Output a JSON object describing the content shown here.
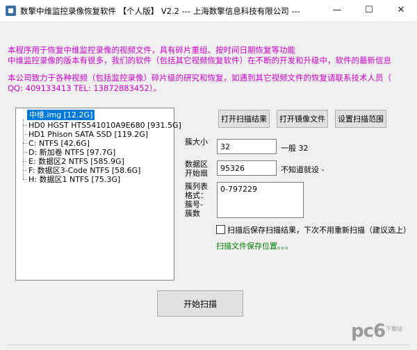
{
  "window": {
    "title": "数擎中维监控录像恢复软件 【个人版】 V2.2 --- 上海数擎信息科技有限公司 ---",
    "minimize_glyph": "—",
    "maximize_glyph": "☐",
    "close_glyph": "✕"
  },
  "info": {
    "line1": "本程序用于恢复中维监控录像的视频文件，具有碎片重组、按时间日期恢复等功能",
    "line2": "中维监控录像的版本有很多，我们的软件（包括其它视频恢复软件）在不断的开发和升级中，软件的最新信息",
    "line3": "本公司致力于各种视频（包括监控录像）碎片级的研究和恢复，如遇到其它视频文件的恢复请联系技术人员（",
    "line4": "QQ: 409133413 TEL: 13872883452）。",
    "color": "#cc00cc"
  },
  "tree": {
    "root": "中维.img  [12.2G]",
    "items": [
      "HD0 HGST HTS541010A9E680 [931.5G]",
      "HD1 Phison SATA SSD [119.2G]",
      "C:  NTFS [42.6G]",
      "D: 新加卷 NTFS [97.7G]",
      "E: 数据区2 NTFS [585.9G]",
      "F: 数据区3-Code NTFS [58.6G]",
      "H: 数据区1 NTFS [75.3G]"
    ]
  },
  "buttons": {
    "open_scan_result": "打开扫描结果",
    "open_image_file": "打开镜像文件",
    "set_scan_range": "设置扫描范围",
    "start_scan": "开始扫描"
  },
  "form": {
    "cluster_size_label": "簇大小",
    "cluster_size_value": "32",
    "cluster_size_hint": "一般 32",
    "data_start_label": "数据区开始扇",
    "data_start_value": "95326",
    "data_start_hint": "不知道就设 -",
    "cluster_list_label": "簇列表格式：簇号-簇数",
    "cluster_list_value": "0-797229"
  },
  "save_after_scan": {
    "checked": false,
    "label": "扫描后保存扫描结果，下次不用重新扫描（建议选上）"
  },
  "status": {
    "text": "扫描文件保存位置。。。",
    "color": "#008000"
  },
  "watermark": {
    "logo": "pc6",
    "sub": "下载站"
  }
}
